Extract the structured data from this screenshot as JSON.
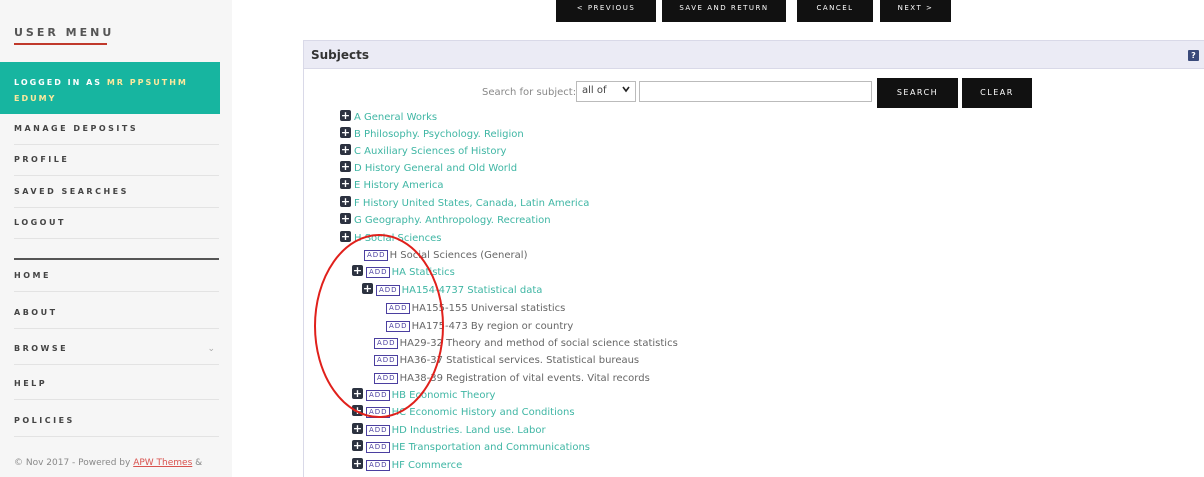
{
  "sidebar": {
    "title": "USER MENU",
    "logged_in_prefix": "LOGGED IN AS",
    "logged_in_user_line1": "MR PPSUTHM",
    "logged_in_user_line2": "EDUMY",
    "items": [
      {
        "label": "MANAGE DEPOSITS"
      },
      {
        "label": "PROFILE"
      },
      {
        "label": "SAVED SEARCHES"
      },
      {
        "label": "LOGOUT"
      },
      {
        "label": "HOME"
      },
      {
        "label": "ABOUT"
      },
      {
        "label": "BROWSE"
      },
      {
        "label": "HELP"
      },
      {
        "label": "POLICIES"
      }
    ],
    "browse_chevron": "⌄",
    "footer_prefix": "© Nov 2017 - Powered by",
    "footer_link": "APW Themes",
    "footer_suffix": "&"
  },
  "toolbar": {
    "previous": "< PREVIOUS",
    "save_return": "SAVE AND RETURN",
    "cancel": "CANCEL",
    "next": "NEXT >"
  },
  "panel": {
    "title": "Subjects",
    "help_icon": "?"
  },
  "search": {
    "label": "Search for subject:",
    "select_value": "all of",
    "select_arrow": "❯",
    "search_button": "SEARCH",
    "clear_button": "CLEAR",
    "input_value": ""
  },
  "tree": {
    "add_label": "ADD",
    "rows": [
      {
        "text": "A General Works"
      },
      {
        "text": "B Philosophy. Psychology. Religion"
      },
      {
        "text": "C Auxiliary Sciences of History"
      },
      {
        "text": "D History General and Old World"
      },
      {
        "text": "E History America"
      },
      {
        "text": "F History United States, Canada, Latin America"
      },
      {
        "text": "G Geography. Anthropology. Recreation"
      },
      {
        "text": "H Social Sciences"
      },
      {
        "text": "H Social Sciences (General)"
      },
      {
        "text": "HA Statistics"
      },
      {
        "text": "HA154-4737 Statistical data"
      },
      {
        "text": "HA155-155 Universal statistics"
      },
      {
        "text": "HA175-473 By region or country"
      },
      {
        "text": "HA29-32 Theory and method of social science statistics"
      },
      {
        "text": "HA36-37 Statistical services. Statistical bureaus"
      },
      {
        "text": "HA38-39 Registration of vital events. Vital records"
      },
      {
        "text": "HB Economic Theory"
      },
      {
        "text": "HC Economic History and Conditions"
      },
      {
        "text": "HD Industries. Land use. Labor"
      },
      {
        "text": "HE Transportation and Communications"
      },
      {
        "text": "HF Commerce"
      }
    ]
  },
  "colors": {
    "accent_teal": "#17b5a0",
    "link_teal": "#3fb6a4",
    "add_purple": "#4b3fa0",
    "annotation_red": "#e0201b"
  }
}
